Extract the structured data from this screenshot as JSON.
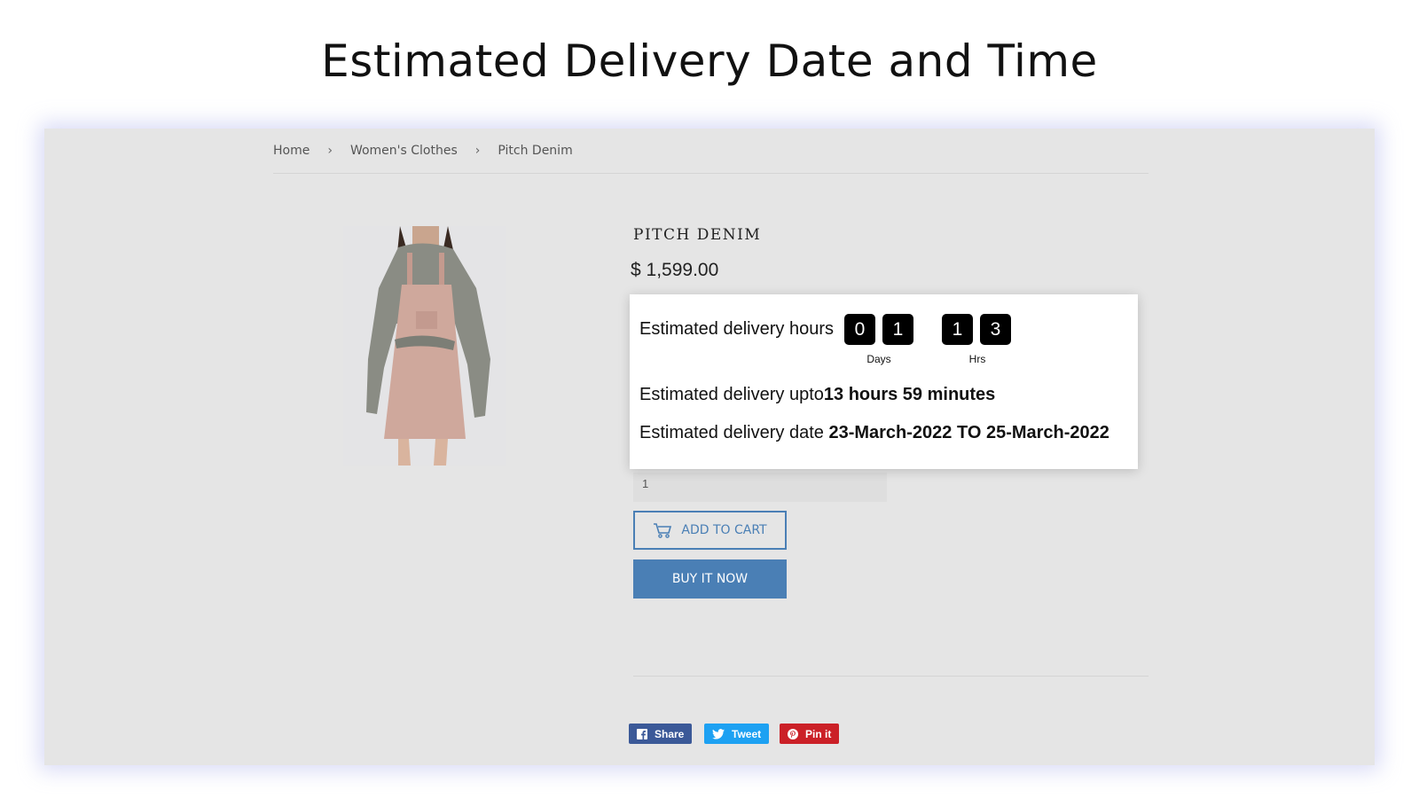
{
  "headline": "Estimated Delivery Date and Time",
  "breadcrumb": {
    "items": [
      "Home",
      "Women's Clothes",
      "Pitch Denim"
    ],
    "separator": "›"
  },
  "product": {
    "title": "PITCH DENIM",
    "price": "$ 1,599.00",
    "quantity": "1"
  },
  "delivery_popup": {
    "hours_label": "Estimated delivery hours",
    "digits": [
      "0",
      "1",
      "1",
      "3"
    ],
    "units": [
      "Days",
      "Hrs"
    ],
    "upto_label": "Estimated delivery upto",
    "upto_value": "13 hours 59 minutes",
    "date_label": "Estimated delivery date",
    "date_value": "23-March-2022 TO 25-March-2022"
  },
  "buttons": {
    "add_to_cart": "ADD TO CART",
    "buy_now": "BUY IT NOW"
  },
  "social": {
    "share": "Share",
    "tweet": "Tweet",
    "pin": "Pin it"
  },
  "colors": {
    "accent": "#4a7fb5",
    "facebook": "#3b5998",
    "twitter": "#1da1f2",
    "pinterest": "#cb2027",
    "frame_bg": "#e5e5e5"
  },
  "icons": [
    "cart-icon",
    "facebook-icon",
    "twitter-icon",
    "pinterest-icon"
  ]
}
